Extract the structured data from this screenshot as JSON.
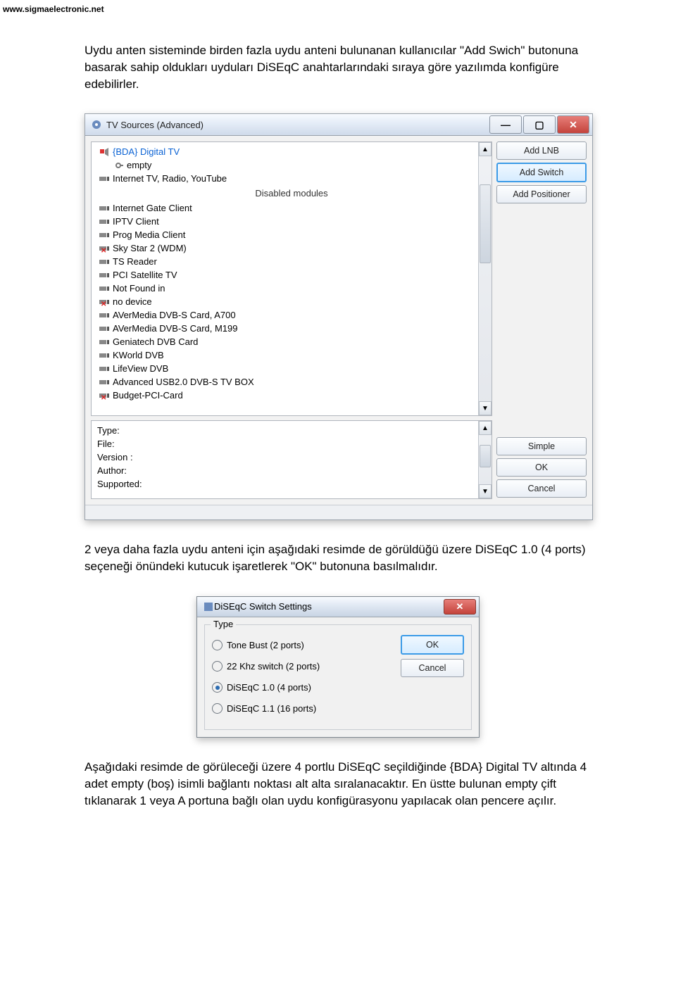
{
  "header": {
    "url": "www.sigmaelectronic.net"
  },
  "paragraphs": {
    "p1": "Uydu anten sisteminde birden fazla uydu anteni bulunanan kullanıcılar \"Add Swich\" butonuna basarak sahip oldukları uyduları DiSEqC anahtarlarındaki sıraya göre yazılımda konfigüre edebilirler.",
    "p2": "2 veya daha fazla uydu anteni için aşağıdaki resimde de görüldüğü üzere DiSEqC 1.0 (4 ports) seçeneği önündeki kutucuk işaretlerek \"OK\" butonuna basılmalıdır.",
    "p3": "Aşağıdaki resimde de görüleceği üzere 4 portlu DiSEqC seçildiğinde {BDA} Digital TV altında 4 adet empty (boş) isimli bağlantı noktası alt alta sıralanacaktır. En üstte bulunan empty çift tıklanarak 1 veya A portuna bağlı olan uydu konfigürasyonu yapılacak olan pencere açılır."
  },
  "win1": {
    "title": "TV Sources (Advanced)",
    "tree": {
      "root_label": "{BDA} Digital TV",
      "empty_label": "empty",
      "mod1_label": "Internet TV, Radio, YouTube",
      "disabled_header": "Disabled modules",
      "items": [
        "Internet Gate Client",
        "IPTV Client",
        "Prog Media Client",
        "Sky Star 2 (WDM)",
        "TS Reader",
        "PCI Satellite TV",
        "Not Found in",
        "no device",
        "AVerMedia DVB-S Card, A700",
        "AVerMedia DVB-S Card, M199",
        "Geniatech DVB Card",
        "KWorld DVB",
        "LifeView DVB",
        "Advanced USB2.0 DVB-S TV BOX",
        "Budget-PCI-Card"
      ]
    },
    "sidebar": {
      "add_lnb": "Add LNB",
      "add_switch": "Add Switch",
      "add_positioner": "Add Positioner"
    },
    "info": {
      "type": "Type:",
      "file": "File:",
      "version": "Version :",
      "author": "Author:",
      "supported": "Supported:"
    },
    "info_buttons": {
      "simple": "Simple",
      "ok": "OK",
      "cancel": "Cancel"
    }
  },
  "win2": {
    "title": "DiSEqC Switch Settings",
    "group": "Type",
    "options": {
      "o1": "Tone Bust  (2 ports)",
      "o2": "22 Khz  switch (2 ports)",
      "o3": "DiSEqC 1.0 (4 ports)",
      "o4": "DiSEqC 1.1 (16 ports)"
    },
    "buttons": {
      "ok": "OK",
      "cancel": "Cancel"
    }
  }
}
